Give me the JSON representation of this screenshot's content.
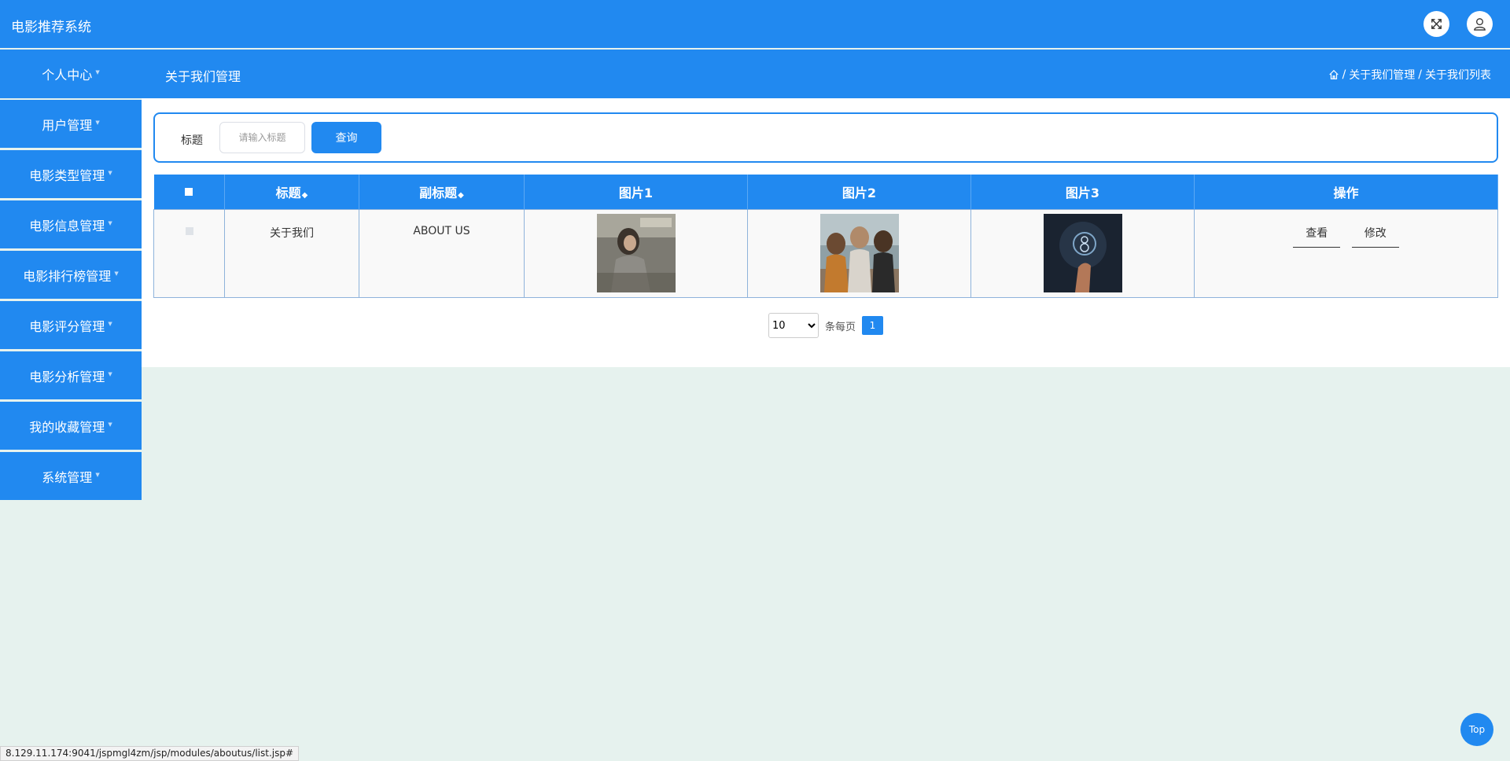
{
  "header": {
    "app_title": "电影推荐系统",
    "fullscreen_icon": "fullscreen-icon",
    "user_icon": "user-icon"
  },
  "subbar": {
    "page_title": "关于我们管理",
    "breadcrumb": [
      "关于我们管理",
      "关于我们列表"
    ],
    "separator": "/"
  },
  "sidebar": {
    "items": [
      {
        "label": "个人中心"
      },
      {
        "label": "用户管理"
      },
      {
        "label": "电影类型管理"
      },
      {
        "label": "电影信息管理"
      },
      {
        "label": "电影排行榜管理"
      },
      {
        "label": "电影评分管理"
      },
      {
        "label": "电影分析管理"
      },
      {
        "label": "我的收藏管理"
      },
      {
        "label": "系统管理"
      }
    ]
  },
  "search": {
    "label": "标题",
    "placeholder": "请输入标题",
    "button": "查询"
  },
  "table": {
    "headers": {
      "title": "标题",
      "subtitle": "副标题",
      "img1": "图片1",
      "img2": "图片2",
      "img3": "图片3",
      "actions": "操作"
    },
    "rows": [
      {
        "title": "关于我们",
        "subtitle": "ABOUT US",
        "view": "查看",
        "edit": "修改"
      }
    ]
  },
  "pager": {
    "page_size": "10",
    "per_page_label": "条每页",
    "current_page": "1"
  },
  "top_button": "Top",
  "status_url": "8.129.11.174:9041/jspmgl4zm/jsp/modules/aboutus/list.jsp#",
  "colors": {
    "primary": "#2189f0",
    "background": "#e6f2ee"
  }
}
